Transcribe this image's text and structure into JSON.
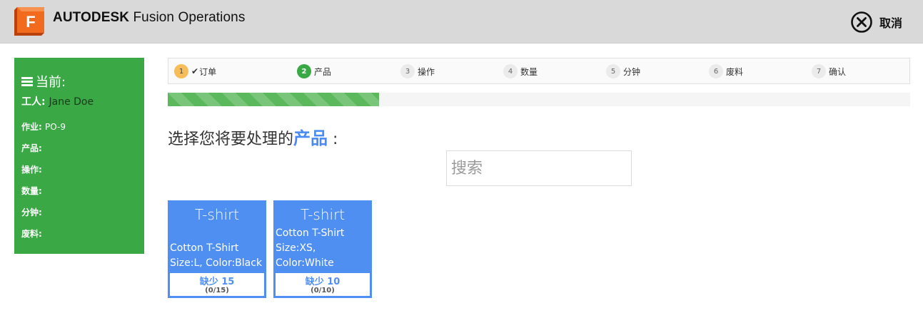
{
  "header": {
    "logo_letter": "F",
    "brand_bold": "AUTODESK",
    "brand_rest": "Fusion Operations",
    "cancel_label": "取消"
  },
  "sidebar": {
    "title": "当前:",
    "worker_label": "工人:",
    "worker_value": "Jane Doe",
    "job_label": "作业:",
    "job_value": "PO-9",
    "product_label": "产品:",
    "operation_label": "操作:",
    "quantity_label": "数量:",
    "minutes_label": "分钟:",
    "scrap_label": "废料:"
  },
  "stepper": {
    "steps": [
      {
        "num": "1",
        "label": "订单",
        "state": "done",
        "check": "✔"
      },
      {
        "num": "2",
        "label": "产品",
        "state": "active"
      },
      {
        "num": "3",
        "label": "操作",
        "state": "pending"
      },
      {
        "num": "4",
        "label": "数量",
        "state": "pending"
      },
      {
        "num": "5",
        "label": "分钟",
        "state": "pending"
      },
      {
        "num": "6",
        "label": "废料",
        "state": "pending"
      },
      {
        "num": "7",
        "label": "确认",
        "state": "pending"
      }
    ]
  },
  "progress": {
    "fraction": 0.285
  },
  "prompt": {
    "prefix": "选择您将要处理的",
    "highlight": "产品",
    "suffix": " :"
  },
  "search": {
    "placeholder": "搜索",
    "value": ""
  },
  "products": [
    {
      "name": "T-shirt",
      "desc_line1": "Cotton T-Shirt",
      "desc_line2": "Size:L, Color:Black",
      "shortage": "缺少 15",
      "count": "(0/15)"
    },
    {
      "name": "T-shirt",
      "desc_line1": "Cotton T-Shirt",
      "desc_line2": "Size:XS,",
      "desc_line3": "Color:White",
      "shortage": "缺少 10",
      "count": "(0/10)"
    }
  ],
  "colors": {
    "header_bg": "#d9d9d9",
    "sidebar_green": "#39a845",
    "accent_blue": "#4f8ff2",
    "progress_green": "#5cb85c",
    "step_done": "#f6bd58"
  },
  "icons": {
    "logo": "fusion-logo-icon",
    "cancel": "close-circle-icon",
    "menu": "hamburger-menu-icon",
    "check": "check-icon"
  }
}
